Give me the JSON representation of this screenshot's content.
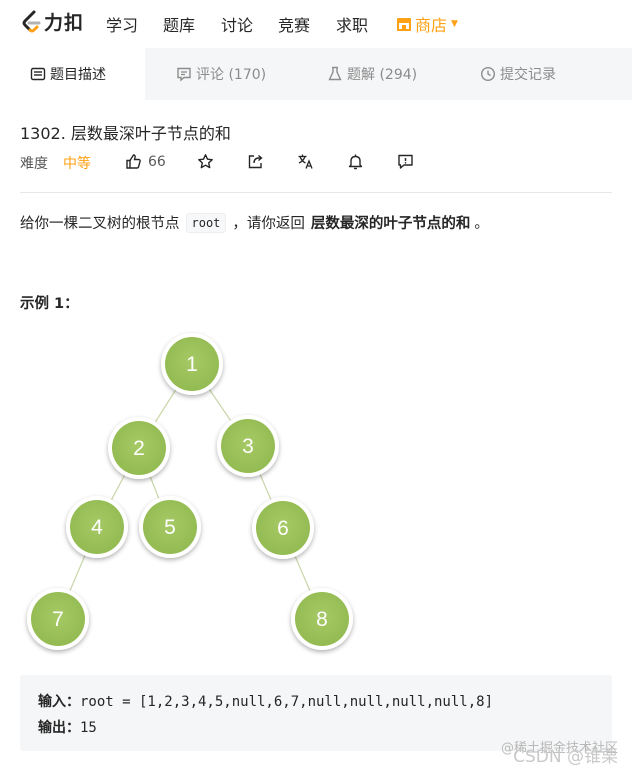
{
  "logo": {
    "text": "力扣"
  },
  "nav": {
    "items": [
      "学习",
      "题库",
      "讨论",
      "竞赛",
      "求职"
    ],
    "shop": "商店"
  },
  "tabs": [
    {
      "label": "题目描述",
      "icon": "description-icon"
    },
    {
      "label": "评论 (170)",
      "icon": "comment-icon"
    },
    {
      "label": "题解 (294)",
      "icon": "flask-icon"
    },
    {
      "label": "提交记录",
      "icon": "clock-icon"
    }
  ],
  "problem": {
    "title": "1302. 层数最深叶子节点的和",
    "difficulty_label": "难度",
    "difficulty_value": "中等",
    "likes": "66",
    "description_before": "给你一棵二叉树的根节点",
    "description_code": "root",
    "description_mid": "，请你返回",
    "description_bold": "层数最深的叶子节点的和",
    "description_after": "。"
  },
  "example": {
    "title": "示例 1：",
    "tree_nodes": [
      "1",
      "2",
      "3",
      "4",
      "5",
      "6",
      "7",
      "8"
    ],
    "input_label": "输入：",
    "input_value": "root = [1,2,3,4,5,null,6,7,null,null,null,null,8]",
    "output_label": "输出：",
    "output_value": "15"
  },
  "colors": {
    "accent": "#ffa116",
    "node_fill": "#9bc25a",
    "tab_bg": "#f5f6f7"
  },
  "watermark": {
    "line1": "@稀土掘金技术社区",
    "line2": "CSDN @锥栗"
  }
}
